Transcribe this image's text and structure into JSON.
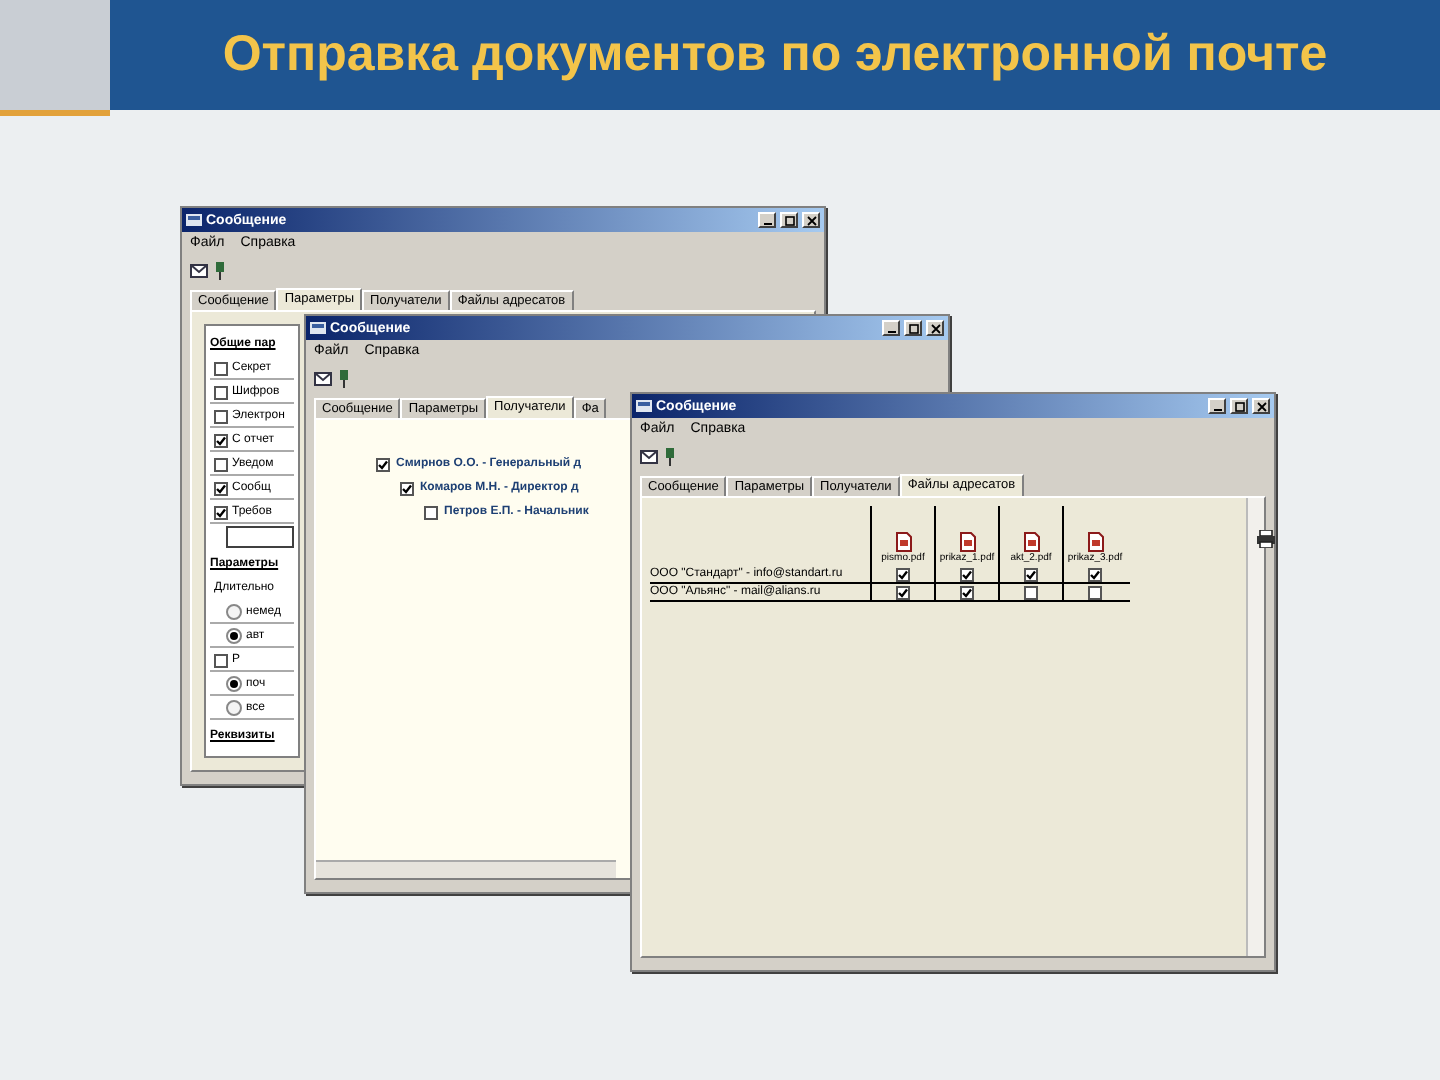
{
  "slide": {
    "title": "Отправка документов по электронной почте"
  },
  "windows": [
    {
      "kind": "options",
      "title": "Сообщение",
      "menu": [
        "Файл",
        "Справка"
      ],
      "tabs": [
        {
          "label": "Сообщение",
          "selected": false
        },
        {
          "label": "Параметры",
          "selected": true
        },
        {
          "label": "Получатели",
          "selected": false
        },
        {
          "label": "Файлы адресатов",
          "selected": false
        }
      ],
      "body": [
        {
          "kind": "heading",
          "label": "Общие пар"
        },
        {
          "kind": "checkbox",
          "label": "Секрет",
          "checked": false
        },
        {
          "kind": "checkbox",
          "label": "Шифров",
          "checked": false
        },
        {
          "kind": "checkbox",
          "label": "Электрон",
          "checked": false
        },
        {
          "kind": "checkbox",
          "label": "С отчет",
          "checked": true
        },
        {
          "kind": "checkbox",
          "label": "Уведом",
          "checked": false
        },
        {
          "kind": "checkbox",
          "label": "Сообщ",
          "checked": true
        },
        {
          "kind": "checkbox",
          "label": "Требов",
          "checked": true
        },
        {
          "kind": "field"
        },
        {
          "kind": "heading",
          "label": "Параметры"
        },
        {
          "kind": "text",
          "label": "Длительно"
        },
        {
          "kind": "radio",
          "label": "немед",
          "selected": false
        },
        {
          "kind": "radio",
          "label": "авт",
          "selected": true
        },
        {
          "kind": "checkbox",
          "label": "Р",
          "checked": false
        },
        {
          "kind": "radio",
          "label": "поч",
          "selected": true
        },
        {
          "kind": "radio",
          "label": "все",
          "selected": false
        },
        {
          "kind": "heading",
          "label": "Реквизиты"
        }
      ]
    },
    {
      "kind": "recipients",
      "title": "Сообщение",
      "menu": [
        "Файл",
        "Справка"
      ],
      "tabs": [
        {
          "label": "Сообщение",
          "selected": false
        },
        {
          "label": "Параметры",
          "selected": false
        },
        {
          "label": "Получатели",
          "selected": true
        },
        {
          "label": "Фа",
          "selected": false
        }
      ],
      "recipients": [
        {
          "label": "Смирнов О.О. - Генеральный д",
          "checked": true,
          "children": [
            {
              "label": "Комаров М.Н. - Директор д",
              "checked": true,
              "children": [
                {
                  "label": "Петров Е.П. - Начальник",
                  "checked": false
                }
              ]
            }
          ]
        }
      ]
    },
    {
      "kind": "files",
      "title": "Сообщение",
      "menu": [
        "Файл",
        "Справка"
      ],
      "tabs": [
        {
          "label": "Сообщение",
          "selected": false
        },
        {
          "label": "Параметры",
          "selected": false
        },
        {
          "label": "Получатели",
          "selected": false
        },
        {
          "label": "Файлы адресатов",
          "selected": true
        }
      ],
      "columns": [
        "pismo.pdf",
        "prikaz_1.pdf",
        "akt_2.pdf",
        "prikaz_3.pdf"
      ],
      "rows": [
        {
          "label": "ООО \"Стандарт\" - info@standart.ru",
          "cells": [
            {
              "checked": true
            },
            {
              "checked": true
            },
            {
              "checked": true
            },
            {
              "checked": true
            }
          ]
        },
        {
          "label": "ООО \"Альянс\" - mail@alians.ru",
          "cells": [
            {
              "checked": true
            },
            {
              "checked": true
            },
            {
              "checked": false
            },
            {
              "checked": false
            }
          ]
        }
      ]
    }
  ]
}
